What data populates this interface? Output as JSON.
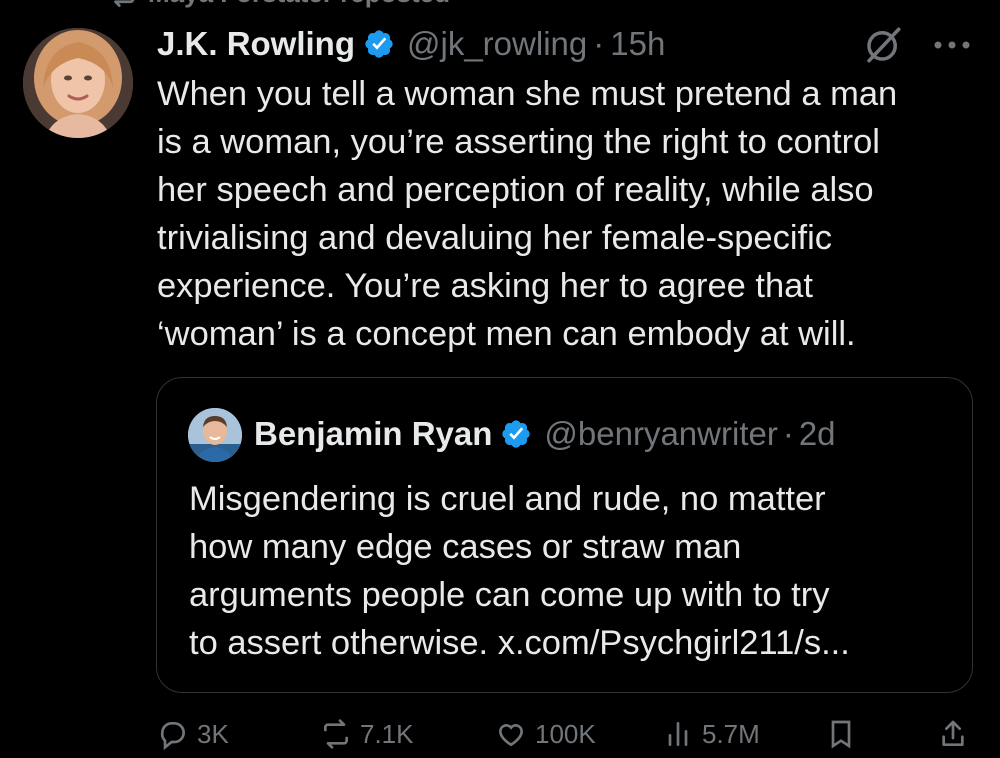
{
  "repost": {
    "text": "Maya Forstater reposted",
    "icon": "repost-icon"
  },
  "tweet": {
    "author": {
      "name": "J.K. Rowling",
      "handle": "@jk_rowling",
      "verified": true,
      "avatar": "avatar-photo"
    },
    "separator": "·",
    "time": "15h",
    "text": "When you tell a woman she must pretend a man\nis a woman, you’re asserting the right to control\nher speech and perception of reality, while also\ntrivialising and devaluing her female-specific\nexperience. You’re asking her to agree that\n‘woman’ is a concept men can embody at will."
  },
  "quote": {
    "author": {
      "name": "Benjamin Ryan",
      "handle": "@benryanwriter",
      "verified": true,
      "avatar": "avatar-photo"
    },
    "separator": "·",
    "time": "2d",
    "text": "Misgendering is cruel and rude, no matter\nhow many edge cases or straw man\narguments people can come up with to try\nto assert otherwise. x.com/Psychgirl211/s..."
  },
  "actions": {
    "replies": "3K",
    "reposts": "7.1K",
    "likes": "100K",
    "views": "5.7M"
  },
  "colors": {
    "background": "#000000",
    "text": "#e7e9ea",
    "muted": "#71767b",
    "verified": "#1d9bf0",
    "border": "#2f3336"
  }
}
